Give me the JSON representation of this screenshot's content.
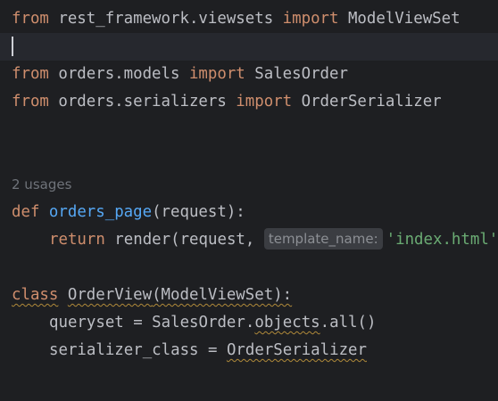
{
  "editor": {
    "language": "python",
    "colors": {
      "background": "#1e1f22",
      "current_line": "#26282e",
      "keyword": "#cf8e6d",
      "function": "#56a8f5",
      "string": "#6aab73",
      "text": "#bcbec4",
      "hint": "#8c8f94"
    },
    "line1": {
      "kw_from": "from",
      "module": " rest_framework.viewsets ",
      "kw_import": "import",
      "name": " ModelViewSet"
    },
    "line3": {
      "kw_from": "from",
      "module": " orders.models ",
      "kw_import": "import",
      "name": " SalesOrder"
    },
    "line4": {
      "kw_from": "from",
      "module": " orders.serializers ",
      "kw_import": "import",
      "name": " OrderSerializer"
    },
    "usages_hint": "2 usages",
    "line_def": {
      "kw_def": "def",
      "func_name": "orders_page",
      "params": "(request):"
    },
    "line_return": {
      "kw_return": "return",
      "call": " render(request, ",
      "param_hint": "template_name:",
      "string_value": "'index.html')"
    },
    "line_class": {
      "kw_class": "class",
      "class_name": "OrderView",
      "bases": "(ModelViewSet):"
    },
    "line_queryset": {
      "attr": "queryset = SalesOrder.",
      "objects": "objects",
      "rest": ".all()"
    },
    "line_serializer": {
      "attr": "serializer_class = ",
      "value": "OrderSerializer"
    }
  }
}
